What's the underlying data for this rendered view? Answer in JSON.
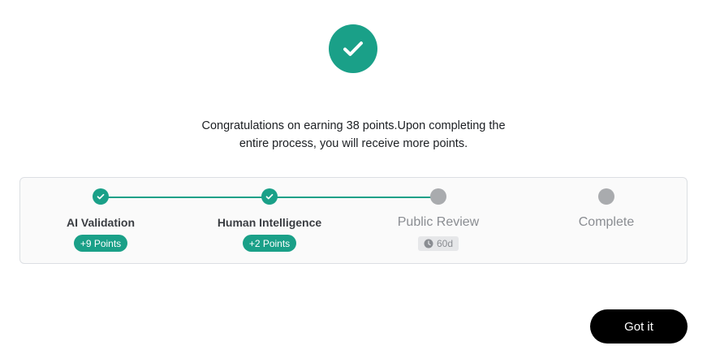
{
  "header": {
    "icon": "check-circle-icon",
    "accent_color": "#1aa088"
  },
  "message": {
    "line1": "Congratulations on earning 38 points.Upon completing the",
    "line2": "entire process, you will receive more points."
  },
  "steps": [
    {
      "label": "AI Validation",
      "status": "done",
      "points": "+9 Points"
    },
    {
      "label": "Human Intelligence",
      "status": "done",
      "points": "+2 Points"
    },
    {
      "label": "Public Review",
      "status": "pending",
      "time": "60d"
    },
    {
      "label": "Complete",
      "status": "pending"
    }
  ],
  "footer": {
    "button_label": "Got it"
  }
}
